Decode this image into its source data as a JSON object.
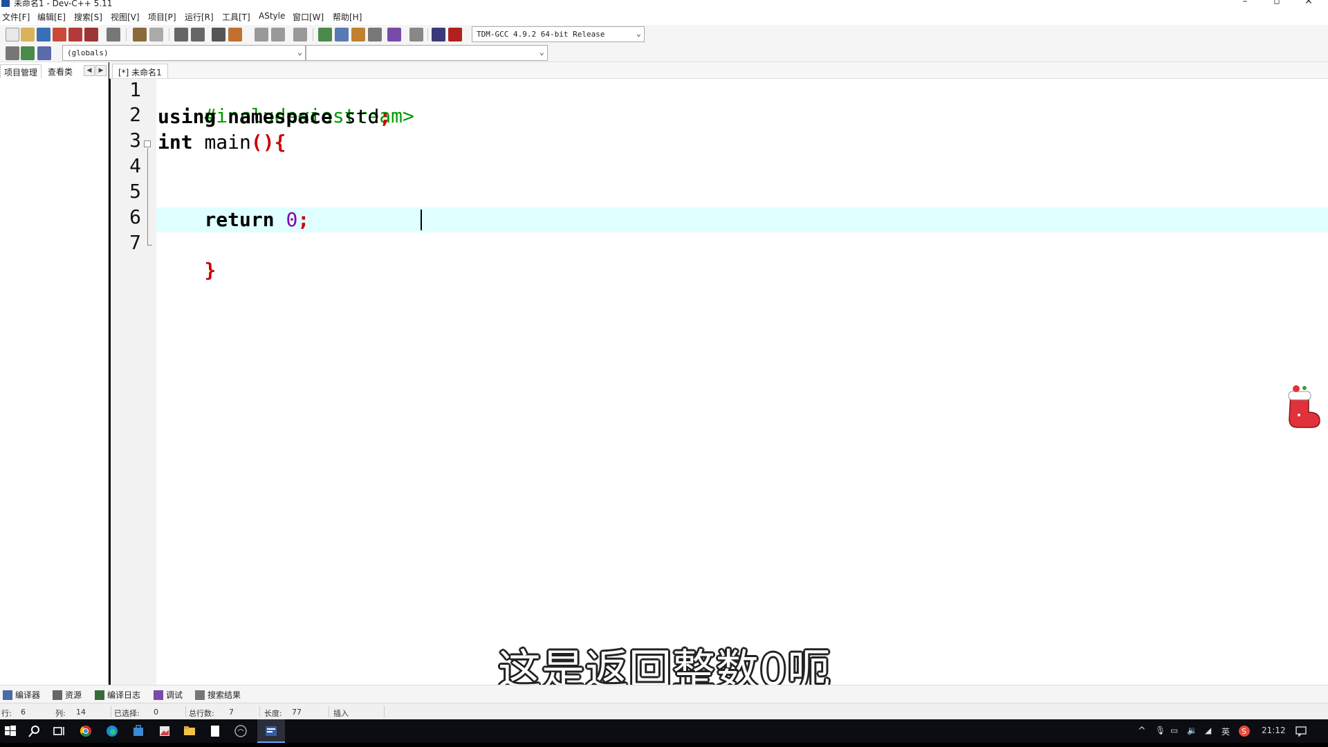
{
  "window": {
    "title": "未命名1 - Dev-C++ 5.11"
  },
  "menu": [
    "文件[F]",
    "编辑[E]",
    "搜索[S]",
    "视图[V]",
    "项目[P]",
    "运行[R]",
    "工具[T]",
    "AStyle",
    "窗口[W]",
    "帮助[H]"
  ],
  "toolbar": {
    "compiler_select": "TDM-GCC 4.9.2 64-bit Release",
    "scope_select": "(globals)",
    "symbol_select": ""
  },
  "left_panel": {
    "tabs": [
      "项目管理",
      "查看类"
    ]
  },
  "editor": {
    "tab_label": "[*] 未命名1",
    "line_numbers": [
      "1",
      "2",
      "3",
      "4",
      "5",
      "6",
      "7"
    ],
    "code": {
      "l1": "#include<iostream>",
      "l2_kw1": "using",
      "l2_kw2": "namespace",
      "l2_rest": "std",
      "l2_semi": ";",
      "l3_kw": "int",
      "l3_name": "main",
      "l3_paren": "()",
      "l3_brace": "{",
      "l6_kw": "return",
      "l6_num": "0",
      "l6_semi": ";",
      "l7_brace": "}"
    },
    "current_line": 6,
    "line_highlight_color": "#e0ffff"
  },
  "subtitle": "这是返回整数0呃",
  "bottom_tabs": [
    "编译器",
    "资源",
    "编译日志",
    "调试",
    "搜索结果"
  ],
  "status": {
    "row_label": "行:",
    "row_value": "6",
    "col_label": "列:",
    "col_value": "14",
    "sel_label": "已选择:",
    "sel_value": "0",
    "total_label": "总行数:",
    "total_value": "7",
    "len_label": "长度:",
    "len_value": "77",
    "mode": "插入"
  },
  "taskbar": {
    "lang": "英",
    "time": "21:12"
  },
  "colors": {
    "preprocessor": "#009900",
    "keyword": "#000000",
    "brace": "#cc0000",
    "number": "#8800aa"
  }
}
